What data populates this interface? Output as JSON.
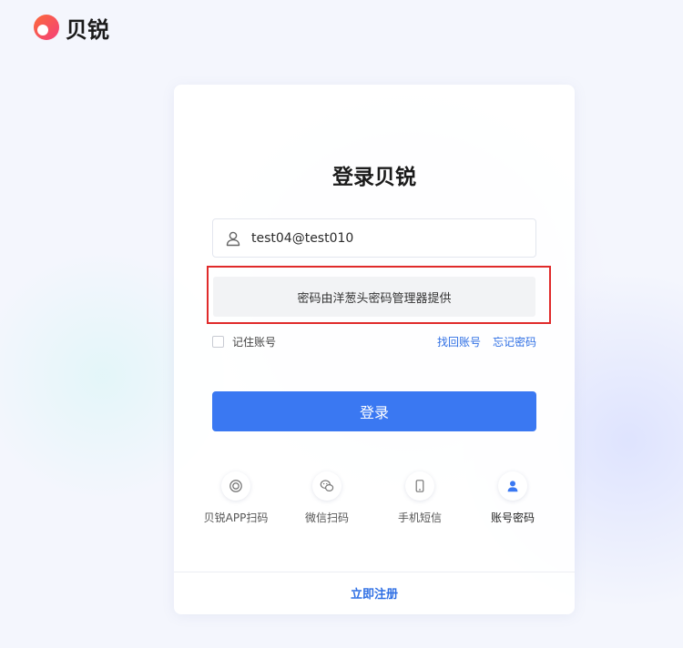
{
  "brand": {
    "name": "贝锐",
    "logo_icon": "beirui-logo-icon",
    "logo_colors": [
      "#f43f7a",
      "#fb6b3a"
    ]
  },
  "login": {
    "title": "登录贝锐",
    "username": {
      "icon": "user-icon",
      "value": "test04@test010"
    },
    "password_notice": "密码由洋葱头密码管理器提供",
    "remember_label": "记住账号",
    "remember_checked": false,
    "find_account": "找回账号",
    "forgot_password": "忘记密码",
    "submit_label": "登录",
    "methods": [
      {
        "label": "贝锐APP扫码",
        "icon": "app-scan-icon",
        "active": false
      },
      {
        "label": "微信扫码",
        "icon": "wechat-icon",
        "active": false
      },
      {
        "label": "手机短信",
        "icon": "phone-icon",
        "active": false
      },
      {
        "label": "账号密码",
        "icon": "account-user-icon",
        "active": true
      }
    ],
    "register": "立即注册"
  },
  "colors": {
    "primary": "#3a78f2",
    "link": "#2f6fe4",
    "highlight_border": "#e02a2a"
  }
}
